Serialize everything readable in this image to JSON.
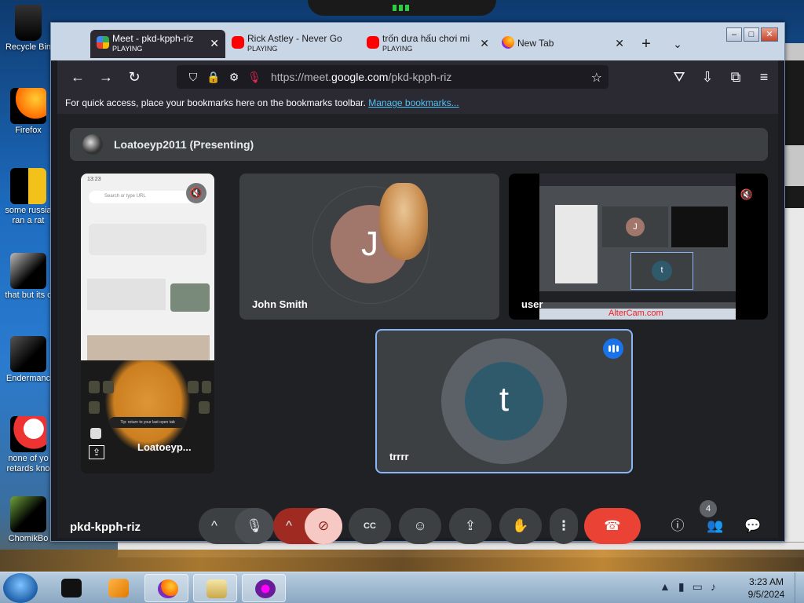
{
  "desktop": {
    "icons": [
      {
        "label": "Recycle Bin"
      },
      {
        "label": "Firefox"
      },
      {
        "label": "some russia ran a rat"
      },
      {
        "label": "that but its c"
      },
      {
        "label": "Endermanc"
      },
      {
        "label": "none of yo retards kno"
      },
      {
        "label": "ChomikBo"
      }
    ]
  },
  "browser": {
    "tabs": [
      {
        "title": "Meet - pkd-kpph-riz",
        "status": "PLAYING",
        "active": true
      },
      {
        "title": "Rick Astley - Never Go",
        "status": "PLAYING"
      },
      {
        "title": "trốn dưa hấu chơi mi",
        "status": "PLAYING"
      },
      {
        "title": "New Tab",
        "status": ""
      }
    ],
    "window_controls": {
      "minimize": "–",
      "maximize": "□",
      "close": "✕"
    },
    "url": {
      "prefix": "https://meet.",
      "domain": "google.com",
      "path": "/pkd-kpph-riz"
    },
    "bookmarks": {
      "text": "For quick access, place your bookmarks here on the bookmarks toolbar.",
      "link": "Manage bookmarks..."
    }
  },
  "meet": {
    "presenter_label": "Loatoeyp2011 (Presenting)",
    "tiles": {
      "phone": {
        "name": "Loatoeyp..."
      },
      "john": {
        "name": "John Smith",
        "initial": "J"
      },
      "user": {
        "name": "user"
      },
      "trrrr": {
        "name": "trrrr",
        "initial": "t"
      }
    },
    "phone_screen": {
      "time": "13:23",
      "search_placeholder": "Search or type URL",
      "hint": "Tip: return to your last open tab"
    },
    "user_screen_watermark": "AlterCam.com",
    "meeting_code": "pkd-kpph-riz",
    "participant_count": "4",
    "icons": {
      "chevron": "^",
      "mic": "🎙",
      "cam_off": "⊘",
      "cc": "CC",
      "emoji": "☺",
      "present": "⇪",
      "hand": "✋",
      "more": "⋮",
      "hangup": "☎",
      "info": "ⓘ",
      "people": "👥",
      "chat": "💬",
      "muted": "🔇"
    }
  },
  "taskbar": {
    "time": "3:23 AM",
    "date": "9/5/2024"
  },
  "colors": {
    "meet_bg": "#202124",
    "tile_bg": "#3c4043",
    "speaking_blue": "#1a73e8",
    "hangup_red": "#ea4335",
    "link_blue": "#4fc3f7"
  }
}
